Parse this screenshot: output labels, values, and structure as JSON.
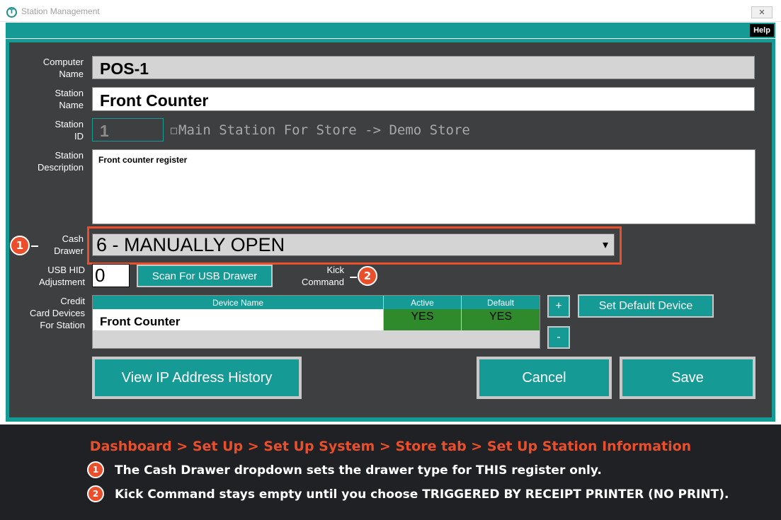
{
  "window": {
    "title": "Station Management",
    "app_icon": "T",
    "close_glyph": "✕",
    "help_label": "Help"
  },
  "form": {
    "computer_name": {
      "label_line1": "Computer",
      "label_line2": "Name",
      "value": "POS-1"
    },
    "station_name": {
      "label_line1": "Station",
      "label_line2": "Name",
      "value": "Front Counter"
    },
    "station_id": {
      "label_line1": "Station",
      "label_line2": "ID",
      "value": "1"
    },
    "main_station": {
      "checkbox_glyph": "□",
      "label": "Main Station For Store -> Demo Store",
      "checked": false
    },
    "station_description": {
      "label_line1": "Station",
      "label_line2": "Description",
      "value": "Front counter register"
    },
    "cash_drawer": {
      "label_line1": "Cash",
      "label_line2": "Drawer",
      "value": "6 - MANUALLY OPEN",
      "arrow_glyph": "▾"
    },
    "usb_hid": {
      "label_line1": "USB HID",
      "label_line2": "Adjustment",
      "value": "0"
    },
    "scan_button": "Scan For USB Drawer",
    "kick_command": {
      "label_line1": "Kick",
      "label_line2": "Command"
    },
    "credit_devices": {
      "label_line1": "Credit",
      "label_line2": "Card Devices",
      "label_line3": "For Station",
      "columns": [
        "Device Name",
        "Active",
        "Default"
      ],
      "rows": [
        {
          "device": "Front Counter",
          "active": "YES",
          "default": "YES"
        }
      ]
    },
    "add_button": "+",
    "remove_button": "-",
    "set_default_button": "Set Default Device"
  },
  "actions": {
    "view_ip": "View IP Address History",
    "cancel": "Cancel",
    "save": "Save"
  },
  "annotations": {
    "badge1": "1",
    "badge2": "2",
    "highlight_color": "#ea4e2b"
  },
  "caption": {
    "breadcrumb": "Dashboard > Set Up > Set Up System > Store tab > Set Up Station Information",
    "note1": "The Cash Drawer dropdown sets the drawer type for THIS register only.",
    "note2": "Kick Command stays empty until you choose TRIGGERED BY RECEIPT PRINTER (NO PRINT)."
  },
  "colors": {
    "teal": "#159a95",
    "panel_dark": "#3d3f41",
    "accent_orange": "#ea4e2b",
    "active_green": "#2f8a2c"
  }
}
